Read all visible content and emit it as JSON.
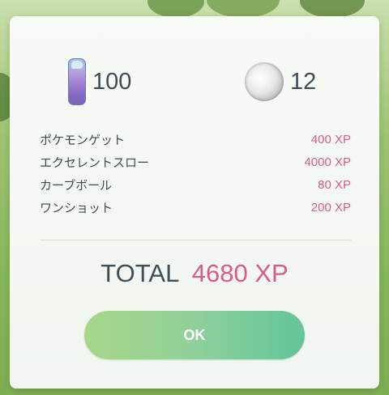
{
  "rewards": [
    {
      "icon": "razz-berry-icon",
      "count": "100"
    },
    {
      "icon": "stardust-icon",
      "count": "12"
    }
  ],
  "bonuses": [
    {
      "label": "ポケモンゲット",
      "xp": "400 XP"
    },
    {
      "label": "エクセレントスロー",
      "xp": "4000 XP"
    },
    {
      "label": "カーブボール",
      "xp": "80 XP"
    },
    {
      "label": "ワンショット",
      "xp": "200 XP"
    }
  ],
  "total": {
    "label": "TOTAL",
    "value": "4680 XP"
  },
  "ok_button": {
    "label": "OK"
  },
  "colors": {
    "xp_pink": "#d85d85",
    "text_dark": "#3e4d55",
    "button_start": "#a8d68a",
    "button_end": "#62c59a"
  }
}
